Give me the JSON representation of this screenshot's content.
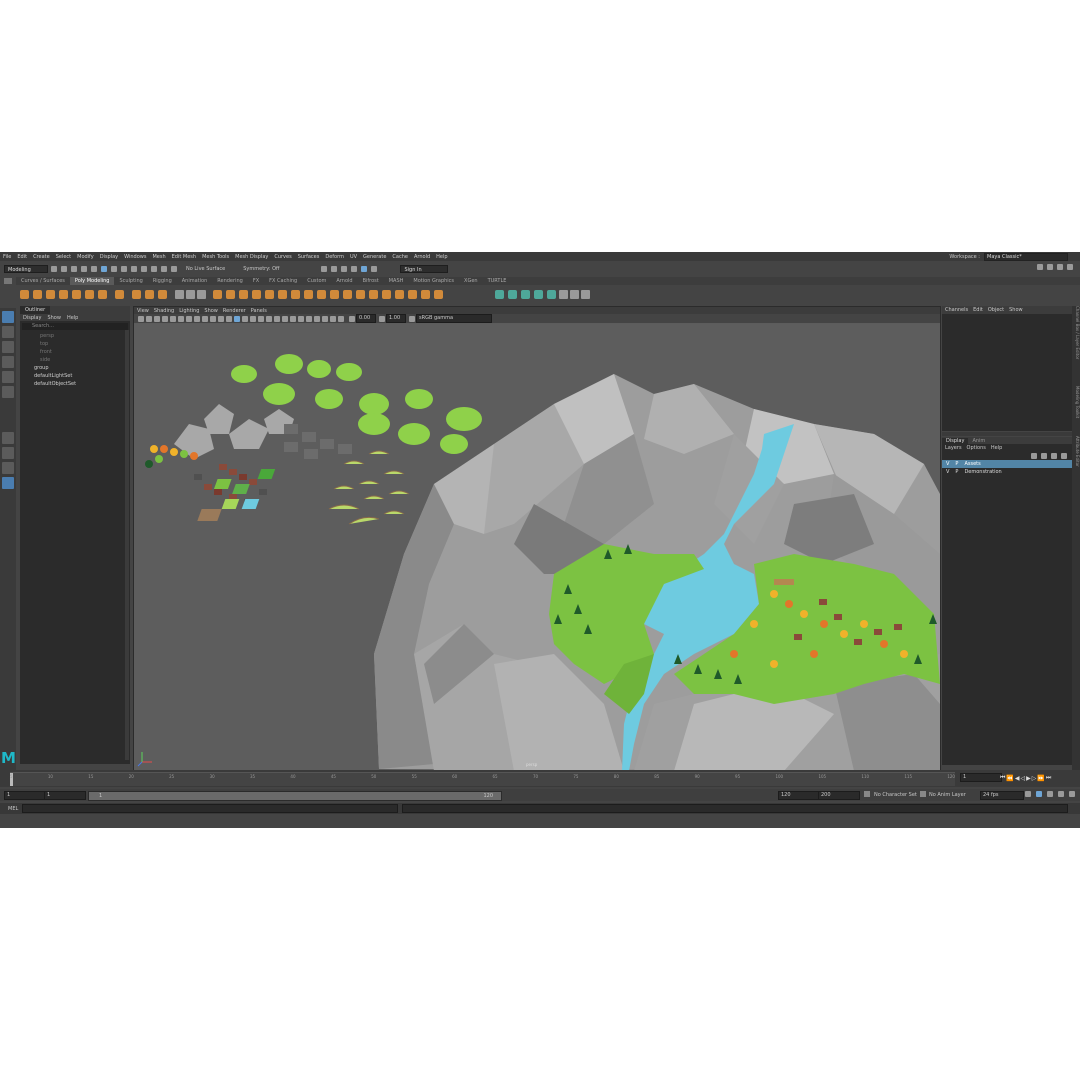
{
  "menu": [
    "File",
    "Edit",
    "Create",
    "Select",
    "Modify",
    "Display",
    "Windows",
    "Mesh",
    "Edit Mesh",
    "Mesh Tools",
    "Mesh Display",
    "Curves",
    "Surfaces",
    "Deform",
    "UV",
    "Generate",
    "Cache",
    "Arnold",
    "Help"
  ],
  "workspace": {
    "label": "Workspace :",
    "value": "Maya Classic*"
  },
  "toolbar": {
    "mode": "Modeling",
    "live_surface": "No Live Surface",
    "symmetry": "Symmetry: Off",
    "sign_in": "Sign In"
  },
  "shelf_tabs": [
    "Curves / Surfaces",
    "Poly Modeling",
    "Sculpting",
    "Rigging",
    "Animation",
    "Rendering",
    "FX",
    "FX Caching",
    "Custom",
    "Arnold",
    "Bifrost",
    "MASH",
    "Motion Graphics",
    "XGen",
    "TURTLE"
  ],
  "shelf_active": "Poly Modeling",
  "outliner": {
    "tab": "Outliner",
    "menu": [
      "Display",
      "Show",
      "Help"
    ],
    "search_placeholder": "Search...",
    "items": [
      "persp",
      "top",
      "front",
      "side",
      "group",
      "defaultLightSet",
      "defaultObjectSet"
    ]
  },
  "viewport": {
    "menu": [
      "View",
      "Shading",
      "Lighting",
      "Show",
      "Renderer",
      "Panels"
    ],
    "field1": "0.00",
    "field2": "1.00",
    "color_space": "sRGB gamma",
    "camera_label": "persp"
  },
  "channel_box": {
    "menu": [
      "Channels",
      "Edit",
      "Object",
      "Show"
    ]
  },
  "layer_editor": {
    "tabs": [
      "Display",
      "Anim"
    ],
    "menu": [
      "Layers",
      "Options",
      "Help"
    ],
    "layers": [
      {
        "v": "V",
        "p": "P",
        "name": "Assets"
      },
      {
        "v": "V",
        "p": "P",
        "name": "Demonstration"
      }
    ]
  },
  "side_tabs": [
    "Channel Box / Layer Editor",
    "Modeling Toolkit",
    "Attribute Editor"
  ],
  "timeline": {
    "ticks": [
      "5",
      "10",
      "15",
      "20",
      "25",
      "30",
      "35",
      "40",
      "45",
      "50",
      "55",
      "60",
      "65",
      "70",
      "75",
      "80",
      "85",
      "90",
      "95",
      "100",
      "105",
      "110",
      "115",
      "120"
    ],
    "current": "1"
  },
  "range": {
    "start": "1",
    "start2": "1",
    "range_start_box": "1",
    "range_end_box": "120",
    "end1": "120",
    "end2": "200",
    "character_set": "No Character Set",
    "anim_layer": "No Anim Layer",
    "fps": "24 fps"
  },
  "mel_label": "MEL",
  "colors": {
    "grass": "#7cc242",
    "rock": "#a6a6a6",
    "water": "#6ecbe0",
    "viewport_bg": "#5d5d5d",
    "highlight": "#5285a6",
    "maya_logo": "#1fb8c8"
  },
  "logo_letter": "M"
}
